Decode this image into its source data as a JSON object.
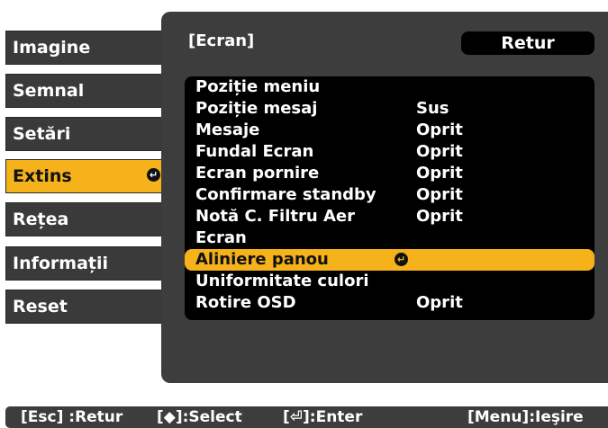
{
  "sidebar": {
    "items": [
      {
        "label": "Imagine",
        "active": false
      },
      {
        "label": "Semnal",
        "active": false
      },
      {
        "label": "Setări",
        "active": false
      },
      {
        "label": "Extins",
        "active": true
      },
      {
        "label": "Rețea",
        "active": false
      },
      {
        "label": "Informații",
        "active": false
      },
      {
        "label": "Reset",
        "active": false
      }
    ]
  },
  "panel": {
    "title": "[Ecran]",
    "back_label": "Retur",
    "rows": [
      {
        "label": "Poziție meniu",
        "value": ""
      },
      {
        "label": "Poziție mesaj",
        "value": "Sus"
      },
      {
        "label": "Mesaje",
        "value": "Oprit"
      },
      {
        "label": "Fundal Ecran",
        "value": "Oprit"
      },
      {
        "label": "Ecran pornire",
        "value": "Oprit"
      },
      {
        "label": "Confirmare standby",
        "value": "Oprit"
      },
      {
        "label": "Notă C. Filtru Aer",
        "value": "Oprit"
      },
      {
        "label": "Ecran",
        "value": ""
      },
      {
        "label": "Aliniere panou",
        "value": "",
        "selected": true
      },
      {
        "label": "Uniformitate culori",
        "value": ""
      },
      {
        "label": "Rotire OSD",
        "value": "Oprit"
      }
    ]
  },
  "footer": {
    "esc": "[Esc] :Retur",
    "select": "[◆]:Select",
    "enter": "[⏎]:Enter",
    "menu": "[Menu]:Ieşire"
  },
  "colors": {
    "accent": "#f5b21a",
    "panel_bg": "#3d3d3d",
    "list_bg": "#000000"
  },
  "icons": {
    "enter": "enter-icon"
  }
}
